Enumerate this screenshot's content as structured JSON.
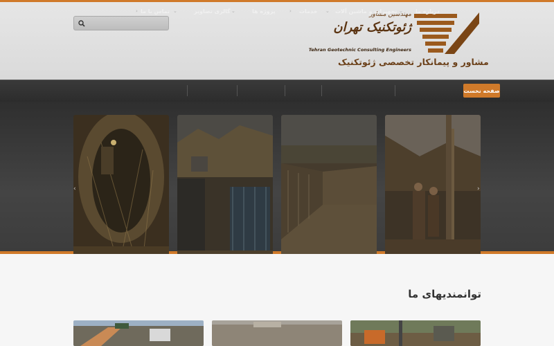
{
  "header": {
    "search": {
      "placeholder": ""
    },
    "logo": {
      "top_text": "مهندسین مشاور",
      "name": "ژئوتکنیک تهران",
      "english": "Tehran Geotechnic Consulting Engineers"
    },
    "tagline": "مشاور و پیمانکار تخصصی ژئوتکنیک"
  },
  "nav": {
    "items": [
      {
        "label": "صفحه نخست",
        "active": true
      },
      {
        "label": "درباره ما",
        "arrow": "⌄"
      },
      {
        "label": "تجهیزات و ماشین آلات",
        "arrow": "⌄"
      },
      {
        "label": "خدمات",
        "arrow": "›"
      },
      {
        "label": "پروژه ها",
        "arrow": "⌄"
      },
      {
        "label": "گالری تصاویر",
        "arrow": "⌄"
      },
      {
        "label": "تماس با ما",
        "arrow": "›"
      }
    ]
  },
  "slider": {
    "prev": "‹",
    "next": "›"
  },
  "section": {
    "title": "توانمندیهای ما"
  },
  "colors": {
    "accent": "#d07a2a",
    "nav_bg": "#333333",
    "header_bg": "#e0e0e0"
  }
}
